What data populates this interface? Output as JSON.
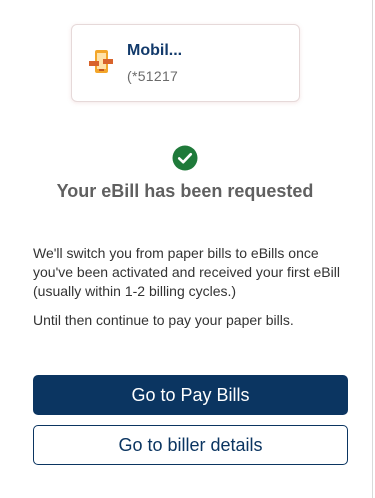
{
  "biller": {
    "name": "Mobil...",
    "account": "(*51217",
    "logo_icon": "mobil-logo-icon"
  },
  "status": {
    "icon": "check-circle-icon",
    "icon_color": "#1f7a3a",
    "headline": "Your eBill has been requested"
  },
  "message": {
    "paragraph_1": "We'll switch you from paper bills to eBills once you've been activated and received your first eBill (usually within 1-2 billing cycles.)",
    "paragraph_2": "Until then continue to pay your paper bills."
  },
  "actions": {
    "primary_label": "Go to Pay Bills",
    "secondary_label": "Go to biller details",
    "brand_color": "#0b3561"
  }
}
